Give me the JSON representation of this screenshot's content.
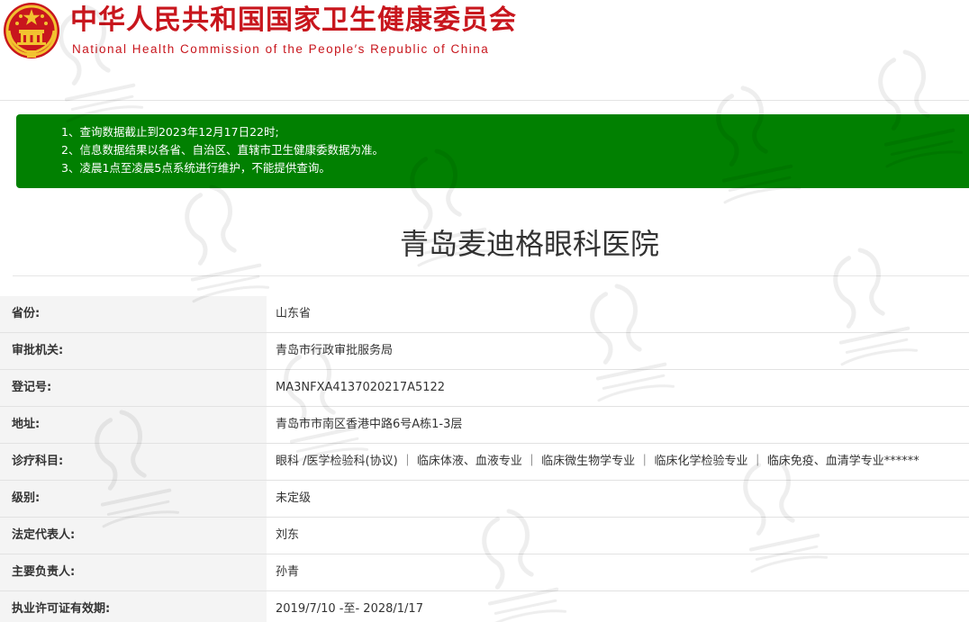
{
  "header": {
    "title_cn": "中华人民共和国国家卫生健康委员会",
    "title_en": "National Health Commission of the People′s Republic of China"
  },
  "notice": {
    "lines": [
      "1、查询数据截止到2023年12月17日22时;",
      "2、信息数据结果以各省、自治区、直辖市卫生健康委数据为准。",
      "3、凌晨1点至凌晨5点系统进行维护，不能提供查询。"
    ]
  },
  "hospital": {
    "name": "青岛麦迪格眼科医院"
  },
  "details": [
    {
      "label": "省份:",
      "value": "山东省"
    },
    {
      "label": "审批机关:",
      "value": "青岛市行政审批服务局"
    },
    {
      "label": "登记号:",
      "value": "MA3NFXA4137020217A5122"
    },
    {
      "label": "地址:",
      "value": "青岛市市南区香港中路6号A栋1-3层"
    },
    {
      "label": "诊疗科目:",
      "value": "眼科 /医学检验科(协议) ｜ 临床体液、血液专业 ｜ 临床微生物学专业 ｜ 临床化学检验专业 ｜ 临床免疫、血清学专业******"
    },
    {
      "label": "级别:",
      "value": "未定级"
    },
    {
      "label": "法定代表人:",
      "value": "刘东"
    },
    {
      "label": "主要负责人:",
      "value": "孙青"
    },
    {
      "label": "执业许可证有效期:",
      "value": "2019/7/10 -至- 2028/1/17"
    }
  ],
  "colors": {
    "brand_red": "#c8161d",
    "notice_green": "#018001",
    "label_bg": "#f4f4f4"
  }
}
